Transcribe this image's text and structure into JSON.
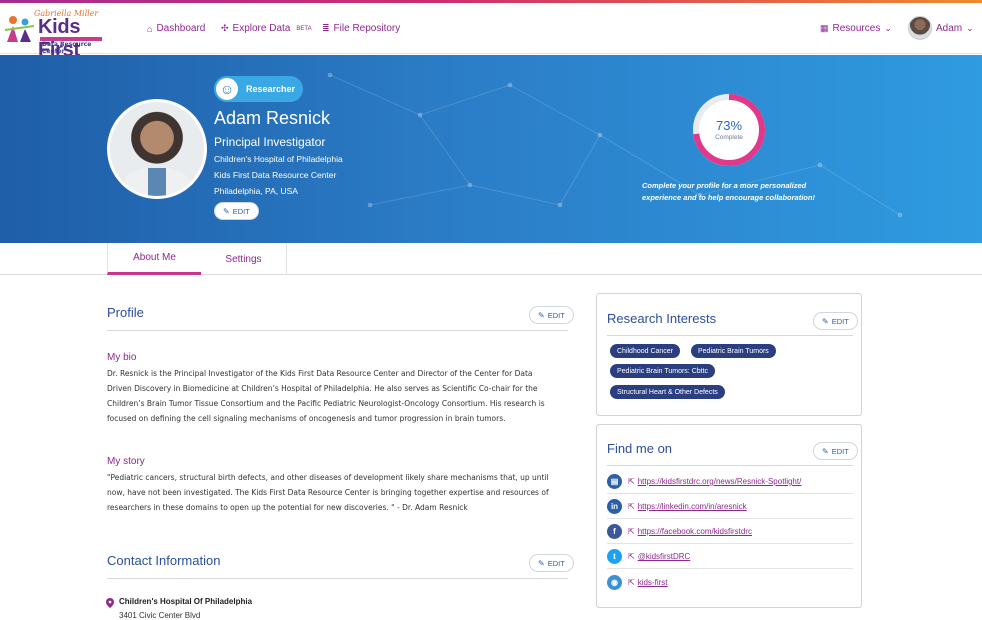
{
  "logo": {
    "script_text": "Gabriella Miller",
    "brand": "Kids First",
    "tagline": "Data Resource Center"
  },
  "nav": {
    "dashboard": "Dashboard",
    "explore": "Explore Data",
    "explore_badge": "BETA",
    "files": "File Repository",
    "resources": "Resources",
    "user": "Adam"
  },
  "profile": {
    "role": "Researcher",
    "name": "Adam Resnick",
    "title": "Principal Investigator",
    "institution": "Children's Hospital of Philadelphia",
    "organization": "Kids First Data Resource Center",
    "location": "Philadelphia, PA, USA",
    "edit": "EDIT",
    "completion": 0.73,
    "completion_label": "73%",
    "completion_caption": "Complete",
    "completion_note": "Complete your profile for a more personalized experience and to help encourage collaboration!"
  },
  "tabs": {
    "about": "About Me",
    "settings": "Settings"
  },
  "about": {
    "profile_title": "Profile",
    "bio_title": "My bio",
    "bio_lines": [
      "Dr. Resnick is the Principal Investigator of the Kids First Data Resource Center and Director of the Center for Data",
      "Driven Discovery in Biomedicine at Children’s Hospital of Philadelphia. He also serves as Scientific Co-chair for the",
      "Children’s Brain Tumor Tissue Consortium and the Pacific Pediatric Neurologist-Oncology Consortium. His research is",
      "focused on defining the cell signaling mechanisms of oncogenesis and tumor progression in brain tumors."
    ],
    "story_title": "My story",
    "story_lines": [
      "\"Pediatric cancers, structural birth defects, and other diseases of development likely share mechanisms that, up until",
      "now, have not been investigated. The Kids First Data Resource Center is bringing together expertise and resources of",
      "researchers in these domains to open up the potential for new discoveries. \" - Dr. Adam Resnick"
    ],
    "contact_title": "Contact Information",
    "address_name": "Children's Hospital Of Philadelphia",
    "address_street": "3401 Civic Center Blvd"
  },
  "interests": {
    "title": "Research Interests",
    "tags": [
      "Childhood Cancer",
      "Pediatric Brain Tumors",
      "Pediatric Brain Tumors: Cbttc",
      "Structural Heart & Other Defects"
    ]
  },
  "find_me": {
    "title": "Find me on",
    "links": [
      {
        "icon": "website-icon",
        "glyph": "▤",
        "text": "https://kidsfirstdrc.org/news/Resnick-Spotlight/"
      },
      {
        "icon": "linkedin-icon",
        "glyph": "in",
        "text": "https://linkedin.com/in/aresnick"
      },
      {
        "icon": "facebook-icon",
        "glyph": "f",
        "text": "https://facebook.com/kidsfirstdrc"
      },
      {
        "icon": "twitter-icon",
        "glyph": "t",
        "text": "@kidsfirstDRC"
      },
      {
        "icon": "github-icon",
        "glyph": "◉",
        "text": "kids-first"
      }
    ]
  },
  "colors": {
    "accent": "#90278e",
    "primary_blue": "#2b5fa8",
    "tag_bg": "#2b3f80",
    "progress": "#e0388b"
  }
}
